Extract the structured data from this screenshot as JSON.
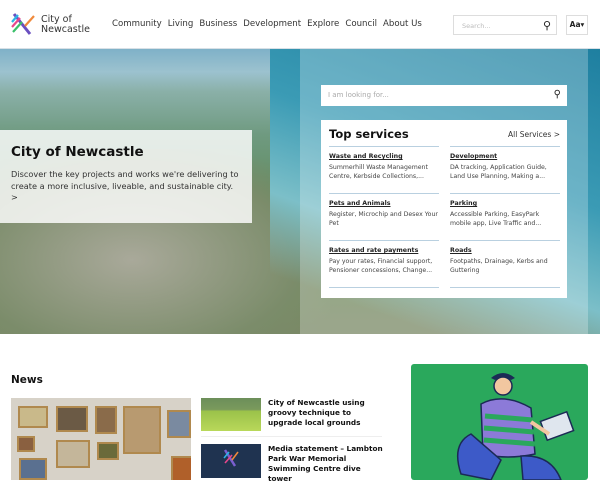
{
  "header": {
    "logo_text_line1": "City of",
    "logo_text_line2": "Newcastle",
    "nav": [
      "Community",
      "Living",
      "Business",
      "Development",
      "Explore",
      "Council",
      "About Us"
    ],
    "search_placeholder": "Search...",
    "text_size_label": "Aa▾"
  },
  "hero": {
    "search_placeholder": "I am looking for...",
    "title": "City of Newcastle",
    "description": "Discover the key projects and works we're delivering to create a more inclusive, liveable, and sustainable city. >"
  },
  "top_services": {
    "title": "Top services",
    "all_label": "All Services >",
    "items": [
      {
        "title": "Waste and Recycling",
        "desc": "Summerhill Waste Management Centre, Kerbside Collections,..."
      },
      {
        "title": "Development",
        "desc": "DA tracking, Application Guide, Land Use Planning, Making a..."
      },
      {
        "title": "Pets and Animals",
        "desc": "Register, Microchip and Desex Your Pet"
      },
      {
        "title": "Parking",
        "desc": "Accessible Parking, EasyPark mobile app, Live Traffic and..."
      },
      {
        "title": "Rates and rate payments",
        "desc": "Pay your rates, Financial support, Pensioner concessions, Change..."
      },
      {
        "title": "Roads",
        "desc": "Footpaths, Drainage, Kerbs and Guttering"
      }
    ]
  },
  "news": {
    "title": "News",
    "items": [
      {
        "headline": "City of Newcastle using groovy technique to upgrade local grounds"
      },
      {
        "headline": "Media statement – Lambton Park War Memorial Swimming Centre dive tower"
      }
    ]
  }
}
